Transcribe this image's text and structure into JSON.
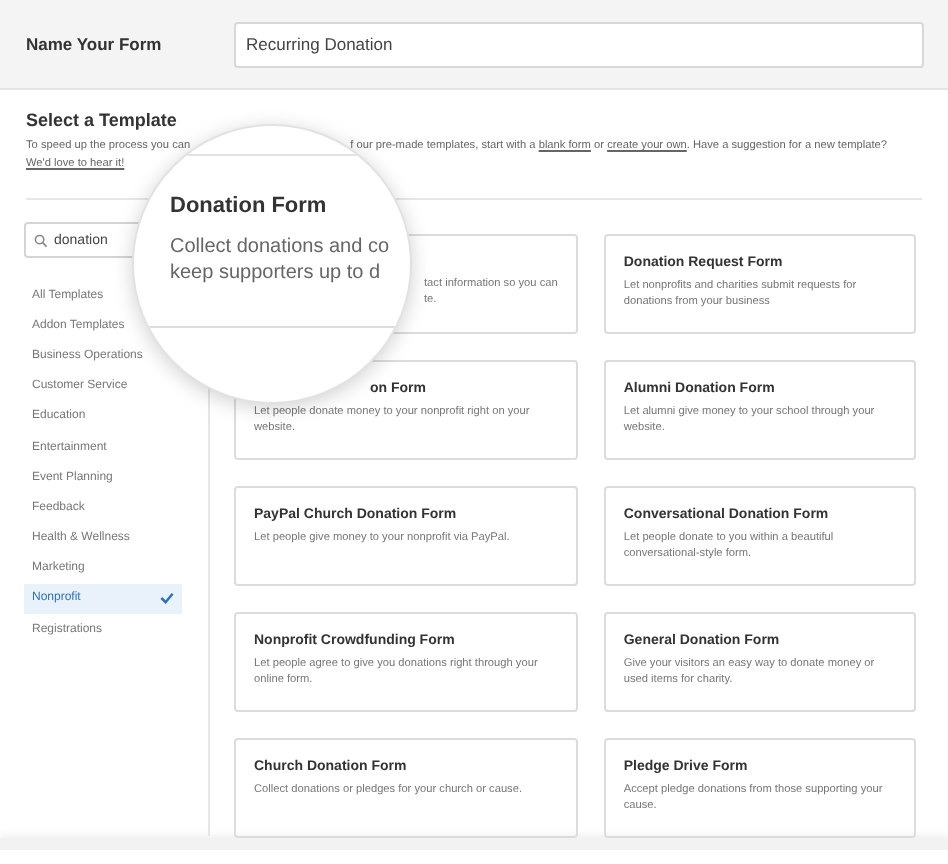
{
  "name_form": {
    "label": "Name Your Form",
    "value": "Recurring Donation"
  },
  "section": {
    "title": "Select a Template",
    "intro": "To speed up the process you can",
    "intro_rest": "f our pre-made templates, start with a",
    "link_blank": "blank form",
    "or": "or",
    "link_create": "create your own",
    "suggest": ". Have a suggestion for a new template?",
    "link_love": "We'd love to hear it!"
  },
  "search": {
    "value": "donation"
  },
  "categories": [
    {
      "label": "All Templates",
      "selected": false
    },
    {
      "label": "Addon Templates",
      "selected": false
    },
    {
      "label": "Business Operations",
      "selected": false
    },
    {
      "label": "Customer Service",
      "selected": false
    },
    {
      "label": "Education",
      "selected": false
    },
    {
      "label": "Entertainment",
      "selected": false
    },
    {
      "label": "Event Planning",
      "selected": false
    },
    {
      "label": "Feedback",
      "selected": false
    },
    {
      "label": "Health & Wellness",
      "selected": false
    },
    {
      "label": "Marketing",
      "selected": false
    },
    {
      "label": "Nonprofit",
      "selected": true
    },
    {
      "label": "Registrations",
      "selected": false
    }
  ],
  "templates": [
    {
      "kind": "title-hidden",
      "description": "tact information so you can",
      "description_2": "te."
    },
    {
      "kind": "full",
      "title": "Donation Request Form",
      "description": "Let nonprofits and charities submit requests for donations from your business"
    },
    {
      "kind": "title-cut",
      "title": "on Form",
      "description": "Let people donate money to your nonprofit right on your website."
    },
    {
      "kind": "full",
      "title": "Alumni Donation Form",
      "description": "Let alumni give money to your school through your website."
    },
    {
      "kind": "full",
      "title": "PayPal Church Donation Form",
      "description": "Let people give money to your nonprofit via PayPal."
    },
    {
      "kind": "full",
      "title": "Conversational Donation Form",
      "description": "Let people donate to you within a beautiful conversational-style form."
    },
    {
      "kind": "full",
      "title": "Nonprofit Crowdfunding Form",
      "description": "Let people agree to give you donations right through your online form."
    },
    {
      "kind": "full",
      "title": "General Donation Form",
      "description": "Give your visitors an easy way to donate money or used items for charity."
    },
    {
      "kind": "full",
      "title": "Church Donation Form",
      "description": "Collect donations or pledges for your church or cause."
    },
    {
      "kind": "full",
      "title": "Pledge Drive Form",
      "description": "Accept pledge donations from those supporting your cause."
    }
  ],
  "magnifier": {
    "title": "Donation Form",
    "line_1": "Collect donations and co",
    "line_2": "keep supporters up to d"
  }
}
